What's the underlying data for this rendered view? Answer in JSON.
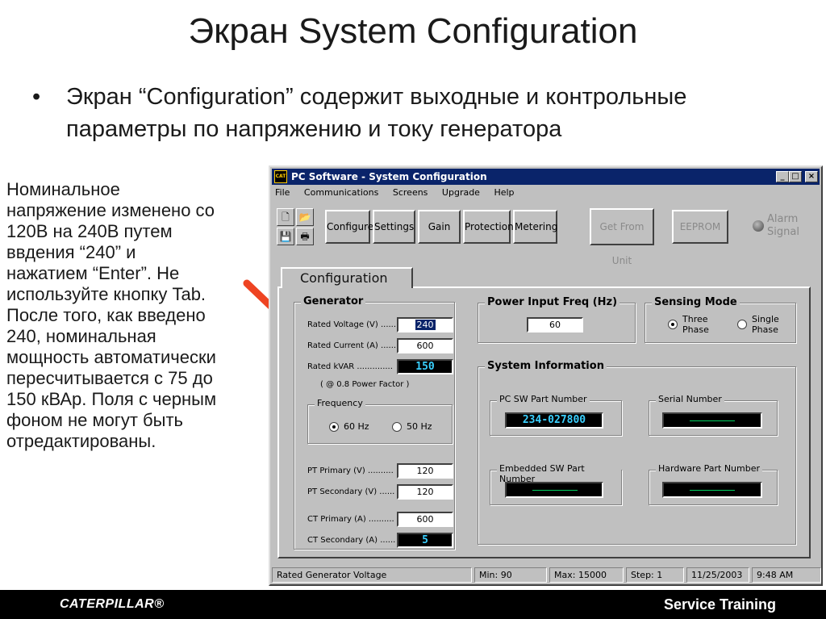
{
  "slide": {
    "title": "Экран System Configuration",
    "bullet_symbol": "•",
    "bullet_line1": "Экран “Configuration” содержит выходные и контрольные",
    "bullet_line2": "параметры по напряжению и току генератора",
    "side_note_lines": [
      "Номинальное",
      "напряжение изменено со",
      "120В на 240В путем",
      "ввдения “240” и",
      "нажатием “Enter”. Не",
      "используйте кнопку Tab.",
      "После того, как введено",
      "240, номинальная",
      "мощность автоматически",
      "пересчитывается с 75 до",
      "150 кВАр. Поля с черным",
      "фоном не могут быть",
      "отредактированы."
    ],
    "arrow_color": "#ee4422"
  },
  "window": {
    "title": "PC Software - System Configuration",
    "title_icon": "CAT",
    "minimize_glyph": "_",
    "maximize_glyph": "□",
    "close_glyph": "×",
    "menu": [
      "File",
      "Communications",
      "Screens",
      "Upgrade",
      "Help"
    ]
  },
  "toolbar": {
    "icons": [
      "new-file-icon",
      "open-folder-icon",
      "save-disk-icon",
      "print-icon"
    ],
    "icon_glyphs": [
      "🗋",
      "📂",
      "💾",
      "🖶"
    ],
    "buttons": [
      "Configure",
      "Settings",
      "Gain",
      "Protection",
      "Metering"
    ],
    "get_from_unit": "Get From Unit",
    "eeprom": "EEPROM",
    "alarm_line1": "Alarm",
    "alarm_line2": "Signal"
  },
  "tab": {
    "label": "Configuration"
  },
  "generator": {
    "title": "Generator",
    "rated_voltage_label": "Rated Voltage (V) ......",
    "rated_voltage_value": "240",
    "rated_current_label": "Rated Current (A) ......",
    "rated_current_value": "600",
    "rated_kvar_label": "Rated kVAR ..............",
    "rated_kvar_value": "150",
    "power_factor_note": "( @ 0.8 Power Factor )",
    "frequency_title": "Frequency",
    "freq_60": "60 Hz",
    "freq_50": "50 Hz",
    "freq_selected": "60 Hz",
    "pt_primary_label": "PT Primary (V) ..........",
    "pt_primary_value": "120",
    "pt_secondary_label": "PT Secondary (V) ......",
    "pt_secondary_value": "120",
    "ct_primary_label": "CT Primary (A) ..........",
    "ct_primary_value": "600",
    "ct_secondary_label": "CT Secondary (A) ......",
    "ct_secondary_value": "5"
  },
  "power_input": {
    "title": "Power Input Freq (Hz)",
    "value": "60"
  },
  "sensing": {
    "title": "Sensing Mode",
    "three_l1": "Three",
    "three_l2": "Phase",
    "single_l1": "Single",
    "single_l2": "Phase",
    "selected": "Three Phase"
  },
  "system_info": {
    "title": "System Information",
    "pc_sw_label": "PC SW Part Number",
    "pc_sw_value": "234-027800",
    "serial_label": "Serial Number",
    "embedded_label": "Embedded SW Part Number",
    "hardware_label": "Hardware Part Number"
  },
  "status": {
    "message": "Rated Generator Voltage",
    "min": "Min: 90",
    "max": "Max: 15000",
    "step": "Step: 1",
    "date": "11/25/2003",
    "time": "9:48 AM"
  },
  "footer": {
    "brand": "CATERPILLAR®",
    "right": "Service Training"
  }
}
